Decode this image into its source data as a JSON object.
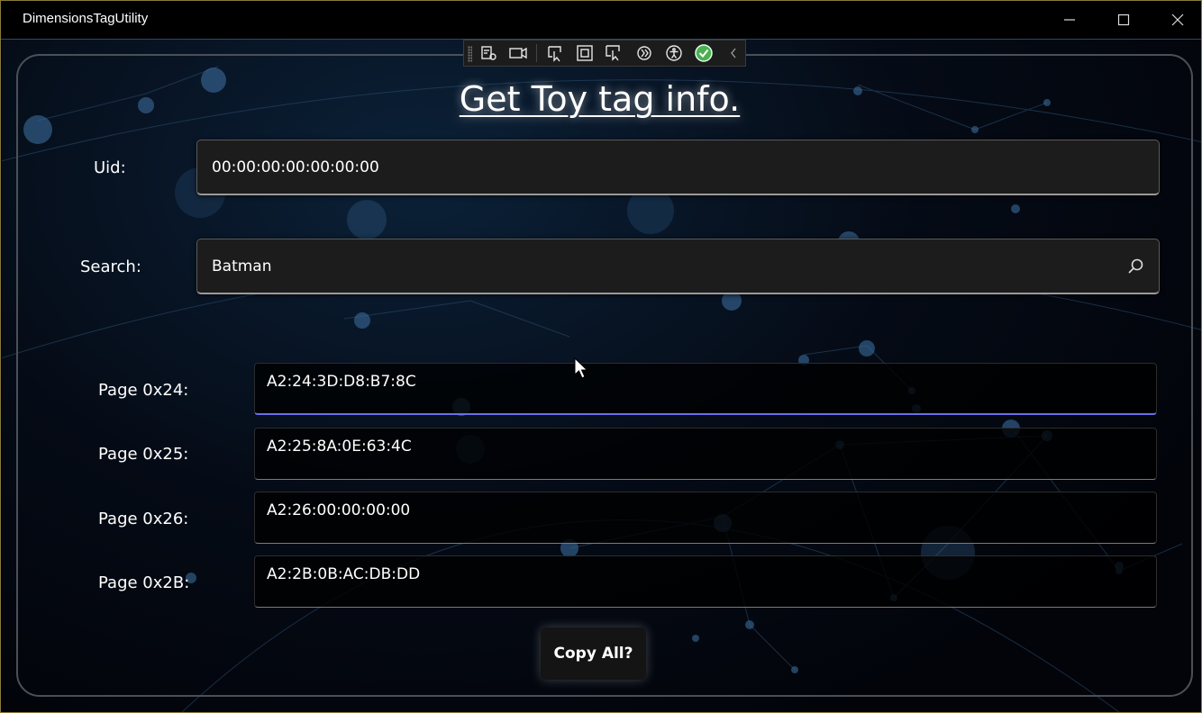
{
  "window": {
    "title": "DimensionsTagUtility",
    "controls": {
      "minimize": "minimize-icon",
      "maximize": "maximize-icon",
      "close": "close-icon"
    }
  },
  "debug_toolbar": {
    "icons": [
      "live-visual-tree-icon",
      "record-icon",
      "select-element-icon",
      "display-layout-adorners-icon",
      "track-focus-icon",
      "hot-reload-icon",
      "accessibility-icon",
      "binding-check-icon",
      "collapse-chevron-icon"
    ],
    "accent": "#4caf50"
  },
  "heading": "Get Toy tag info.",
  "uid": {
    "label": "Uid:",
    "value": "00:00:00:00:00:00:00"
  },
  "search": {
    "label": "Search:",
    "value": "Batman",
    "icon": "search-icon"
  },
  "pages": [
    {
      "label": "Page 0x24:",
      "value": "A2:24:3D:D8:B7:8C"
    },
    {
      "label": "Page 0x25:",
      "value": "A2:25:8A:0E:63:4C"
    },
    {
      "label": "Page 0x26:",
      "value": "A2:26:00:00:00:00"
    },
    {
      "label": "Page 0x2B:",
      "value": "A2:2B:0B:AC:DB:DD"
    }
  ],
  "copy_button": "Copy All?",
  "colors": {
    "focus_accent": "#6b6fe8",
    "frame": "#8a7a3a"
  }
}
